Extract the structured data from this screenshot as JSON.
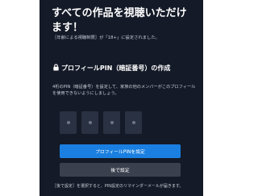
{
  "colors": {
    "panel_background": "#141a27",
    "primary_button": "#1a7fe0",
    "secondary_button": "#3a404e",
    "pin_box": "#2a3142",
    "text": "#ffffff"
  },
  "header": {
    "title": "すべての作品を視聴いただけます！"
  },
  "notice": {
    "text": "［年齢による視聴制限］が「18+」に設定されました。"
  },
  "pin_section": {
    "icon": "lock-icon",
    "heading": "プロフィールPIN（暗証番号）の作成",
    "description": "4桁のPIN（暗証番号）を設定して、家族の他のメンバーがこのプロフィールを使用できないようにしましょう。",
    "digits": [
      "",
      "",
      "",
      ""
    ]
  },
  "buttons": {
    "set_pin": "プロフィールPINを設定",
    "later": "後で設定"
  },
  "footer": {
    "text": "［後で設定］を選択すると、PIN設定のリマインダーメールが届きます。"
  }
}
